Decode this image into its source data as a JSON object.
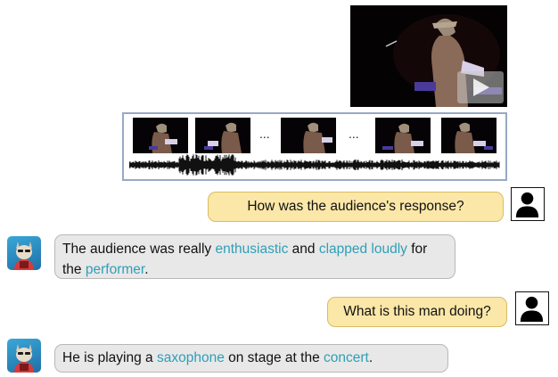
{
  "media": {
    "video_icon": "play-icon",
    "frames_icon": "video-frame-thumbnails",
    "waveform_icon": "audio-waveform",
    "ellipsis": [
      "...",
      "..."
    ]
  },
  "chat": [
    {
      "role": "user",
      "avatar": "person-icon",
      "text": "How was the audience's response?"
    },
    {
      "role": "assistant",
      "avatar": "llama-avatar",
      "line1": [
        {
          "t": "The audience was really "
        },
        {
          "t": "enthusiastic",
          "kw": true
        },
        {
          "t": " and "
        },
        {
          "t": "clapped loudly",
          "kw": true
        },
        {
          "t": " for"
        }
      ],
      "line2": [
        {
          "t": "the "
        },
        {
          "t": "performer",
          "kw": true
        },
        {
          "t": "."
        }
      ]
    },
    {
      "role": "user",
      "avatar": "person-icon",
      "text": "What is this man doing?"
    },
    {
      "role": "assistant",
      "avatar": "llama-avatar",
      "line1": [
        {
          "t": "He is playing a "
        },
        {
          "t": "saxophone",
          "kw": true
        },
        {
          "t": " on stage at the "
        },
        {
          "t": "concert",
          "kw": true
        },
        {
          "t": "."
        }
      ]
    }
  ],
  "colors": {
    "keyword": "#2e9fb8",
    "user_bubble": "#fbe7a8",
    "bot_bubble": "#e8e8e8"
  }
}
